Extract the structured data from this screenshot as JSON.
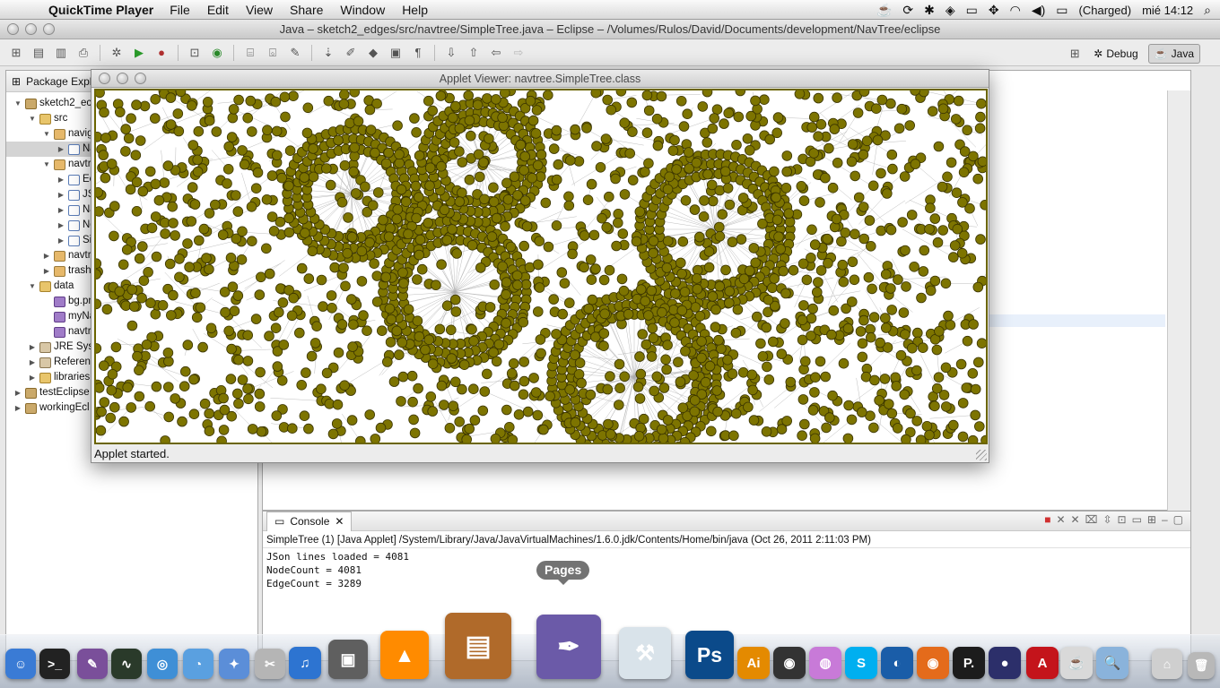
{
  "menubar": {
    "app_name": "QuickTime Player",
    "items": [
      "File",
      "Edit",
      "View",
      "Share",
      "Window",
      "Help"
    ],
    "battery": "(Charged)",
    "clock": "mié 14:12"
  },
  "eclipse": {
    "title": "Java – sketch2_edges/src/navtree/SimpleTree.java – Eclipse – /Volumes/Rulos/David/Documents/development/NavTree/eclipse",
    "perspectives": {
      "debug": "Debug",
      "java": "Java"
    }
  },
  "package_explorer": {
    "tab_label": "Package Explo",
    "rows": [
      {
        "label": "sketch2_ec",
        "depth": 0,
        "twisty": "▼",
        "icon": "proj"
      },
      {
        "label": "src",
        "depth": 1,
        "twisty": "▼",
        "icon": "folder"
      },
      {
        "label": "navig",
        "depth": 2,
        "twisty": "▼",
        "icon": "pkg"
      },
      {
        "label": "Na",
        "depth": 3,
        "twisty": "▶",
        "icon": "java",
        "selected": true
      },
      {
        "label": "navtr",
        "depth": 2,
        "twisty": "▼",
        "icon": "pkg"
      },
      {
        "label": "Ec",
        "depth": 3,
        "twisty": "▶",
        "icon": "java"
      },
      {
        "label": "JS",
        "depth": 3,
        "twisty": "▶",
        "icon": "java"
      },
      {
        "label": "Na",
        "depth": 3,
        "twisty": "▶",
        "icon": "java"
      },
      {
        "label": "No",
        "depth": 3,
        "twisty": "▶",
        "icon": "java"
      },
      {
        "label": "Si",
        "depth": 3,
        "twisty": "▶",
        "icon": "java"
      },
      {
        "label": "navtr",
        "depth": 2,
        "twisty": "▶",
        "icon": "pkg"
      },
      {
        "label": "trash",
        "depth": 2,
        "twisty": "▶",
        "icon": "pkg"
      },
      {
        "label": "data",
        "depth": 1,
        "twisty": "▼",
        "icon": "folder"
      },
      {
        "label": "bg.pn",
        "depth": 2,
        "twisty": "",
        "icon": "file"
      },
      {
        "label": "myNa",
        "depth": 2,
        "twisty": "",
        "icon": "file"
      },
      {
        "label": "navtr",
        "depth": 2,
        "twisty": "",
        "icon": "file"
      },
      {
        "label": "JRE Syst",
        "depth": 1,
        "twisty": "▶",
        "icon": "lib"
      },
      {
        "label": "Referen",
        "depth": 1,
        "twisty": "▶",
        "icon": "lib"
      },
      {
        "label": "libraries",
        "depth": 1,
        "twisty": "▶",
        "icon": "folder"
      },
      {
        "label": "testEclipse",
        "depth": 0,
        "twisty": "▶",
        "icon": "proj"
      },
      {
        "label": "workingEcl",
        "depth": 0,
        "twisty": "▶",
        "icon": "proj"
      }
    ]
  },
  "applet": {
    "title": "Applet Viewer: navtree.SimpleTree.class",
    "status": "Applet started.",
    "node_color": "#7d7400",
    "node_stroke": "#3b3500"
  },
  "console": {
    "tab_label": "Console",
    "description": "SimpleTree (1) [Java Applet] /System/Library/Java/JavaVirtualMachines/1.6.0.jdk/Contents/Home/bin/java (Oct 26, 2011 2:11:03 PM)",
    "lines": [
      "JSon lines loaded = 4081",
      "NodeCount = 4081",
      "EdgeCount = 3289"
    ]
  },
  "dock": {
    "tooltip": "Pages",
    "apps": [
      {
        "name": "Finder",
        "color": "#3a7bd5",
        "glyph": "☺"
      },
      {
        "name": "Terminal",
        "color": "#222222",
        "glyph": ">_"
      },
      {
        "name": "Script Editor",
        "color": "#7a4f9a",
        "glyph": "✎"
      },
      {
        "name": "Activity Monitor",
        "color": "#2a3a2a",
        "glyph": "∿"
      },
      {
        "name": "Safari",
        "color": "#3f8fd6",
        "glyph": "◎"
      },
      {
        "name": "iChat",
        "color": "#5aa0e0",
        "glyph": "◔"
      },
      {
        "name": "Network Utility",
        "color": "#5b8ed8",
        "glyph": "✦"
      },
      {
        "name": "TextWrangler",
        "color": "#b5b5b5",
        "glyph": "✂"
      },
      {
        "name": "iTunes",
        "color": "#2d74d1",
        "glyph": "♫"
      },
      {
        "name": "iPhoto",
        "color": "#5f5f5f",
        "glyph": "▣"
      },
      {
        "name": "VLC",
        "color": "#ff8b00",
        "glyph": "▲"
      },
      {
        "name": "Keynote",
        "color": "#b06a2a",
        "glyph": "▤"
      },
      {
        "name": "Pages",
        "color": "#6b5aa8",
        "glyph": "✒"
      },
      {
        "name": "Utilities",
        "color": "#d9e3ea",
        "glyph": "⚒"
      },
      {
        "name": "Photoshop",
        "color": "#0b4a8a",
        "glyph": "Ps"
      },
      {
        "name": "Illustrator",
        "color": "#e48a00",
        "glyph": "Ai"
      },
      {
        "name": "Photo Booth",
        "color": "#333333",
        "glyph": "◉"
      },
      {
        "name": "Color Picker",
        "color": "#c87ad8",
        "glyph": "◍"
      },
      {
        "name": "Skype",
        "color": "#00aff0",
        "glyph": "S"
      },
      {
        "name": "Globe",
        "color": "#1a5da8",
        "glyph": "◐"
      },
      {
        "name": "Firefox",
        "color": "#e46b1b",
        "glyph": "◉"
      },
      {
        "name": "Processing",
        "color": "#1c1c1c",
        "glyph": "P."
      },
      {
        "name": "Eclipse",
        "color": "#2c2f6a",
        "glyph": "●"
      },
      {
        "name": "Acrobat",
        "color": "#c4141b",
        "glyph": "A"
      },
      {
        "name": "Java Prefs",
        "color": "#d9d9d9",
        "glyph": "☕"
      },
      {
        "name": "Preview",
        "color": "#8ab3db",
        "glyph": "🔍"
      },
      {
        "name": "Downloads",
        "color": "#cfcfcf",
        "glyph": "⌂"
      },
      {
        "name": "Trash",
        "color": "#b8b8b8",
        "glyph": "🗑"
      }
    ]
  }
}
